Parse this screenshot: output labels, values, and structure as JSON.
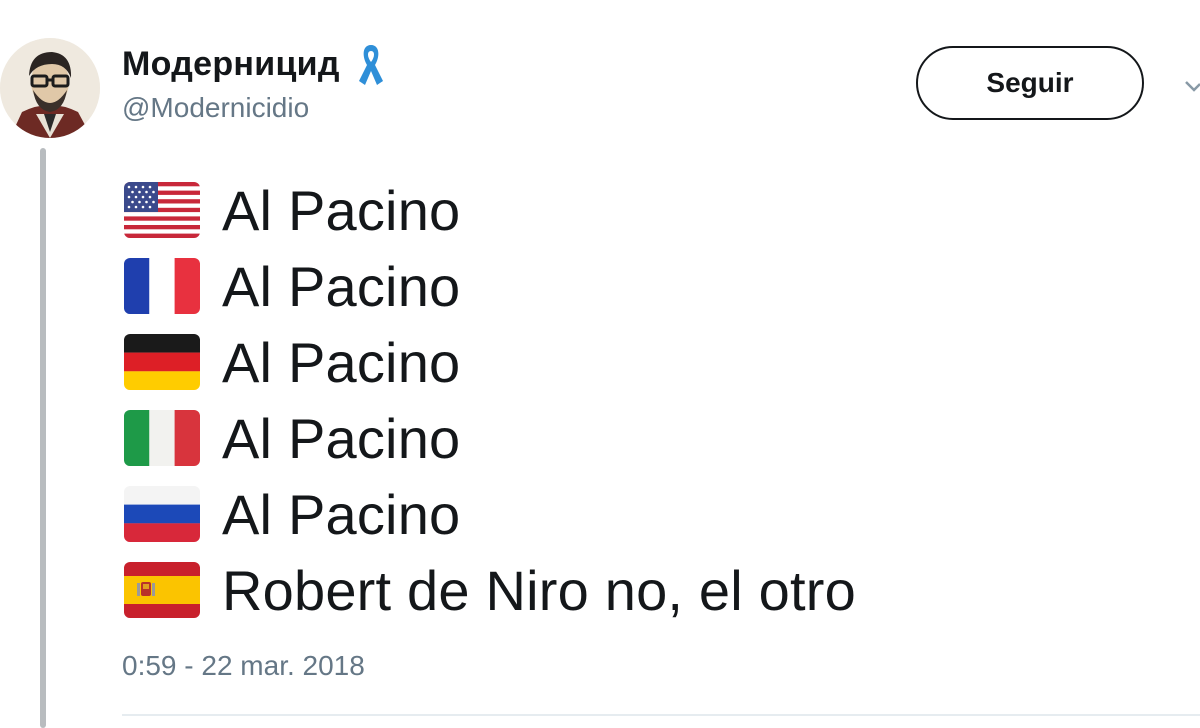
{
  "author": {
    "display_name": "Модерницид",
    "handle": "@Modernicidio",
    "avatar_icon": "avatar-illustration",
    "badge_icon": "awareness-ribbon-icon",
    "badge_color": "#2f8fd8"
  },
  "actions": {
    "follow_label": "Seguir",
    "menu_icon": "chevron-down-icon"
  },
  "tweet": {
    "lines": [
      {
        "flag": "flag-usa-icon",
        "text": "Al Pacino"
      },
      {
        "flag": "flag-france-icon",
        "text": "Al Pacino"
      },
      {
        "flag": "flag-germany-icon",
        "text": "Al Pacino"
      },
      {
        "flag": "flag-italy-icon",
        "text": "Al Pacino"
      },
      {
        "flag": "flag-russia-icon",
        "text": "Al Pacino"
      },
      {
        "flag": "flag-spain-icon",
        "text": "Robert de Niro no, el otro"
      }
    ],
    "timestamp": "0:59 - 22 mar. 2018"
  },
  "colors": {
    "text_primary": "#14171a",
    "text_secondary": "#657786",
    "thread_line": "#b8bcbf"
  }
}
